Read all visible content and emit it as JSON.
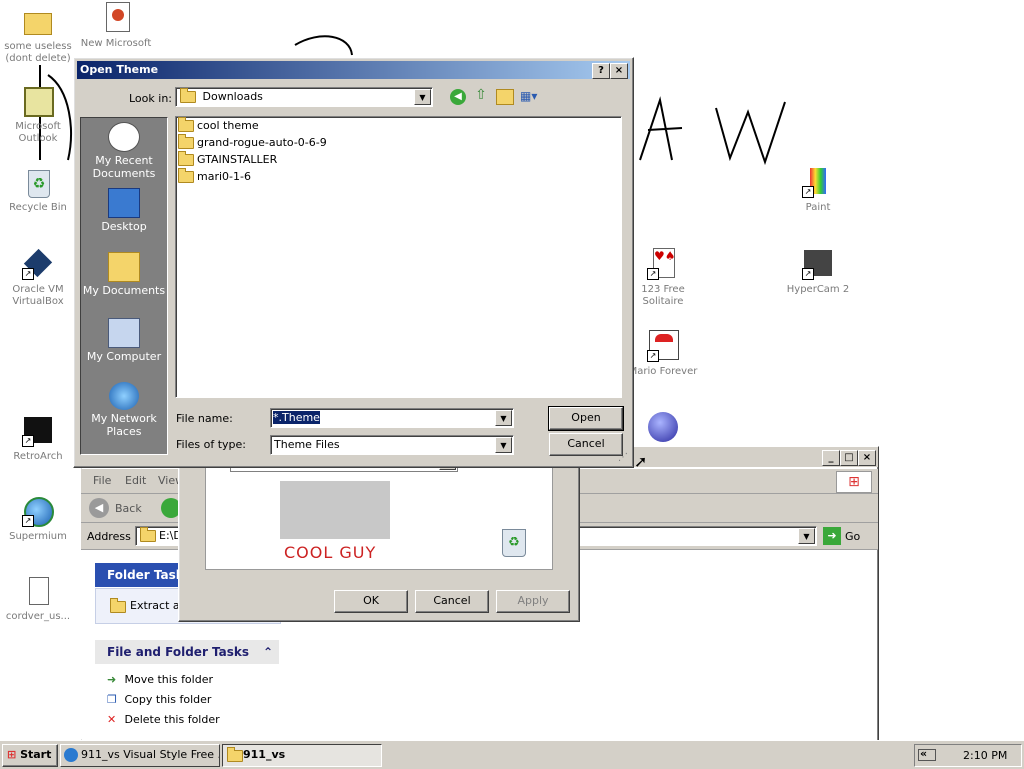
{
  "desktop": {
    "icons": [
      {
        "label": "some useless (dont delete)",
        "icon": "folder-icon"
      },
      {
        "label": "New Microsoft",
        "icon": "powerpoint-icon"
      },
      {
        "label": "Microsoft Outlook",
        "icon": "outlook-icon"
      },
      {
        "label": "Recycle Bin",
        "icon": "recycle-bin-icon"
      },
      {
        "label": "Oracle VM VirtualBox",
        "icon": "virtualbox-icon"
      },
      {
        "label": "RetroArch",
        "icon": "retroarch-icon"
      },
      {
        "label": "Supermium",
        "icon": "browser-icon"
      },
      {
        "label": "cordver_us...",
        "icon": "document-icon"
      },
      {
        "label": "Paint",
        "icon": "paint-icon"
      },
      {
        "label": "HyperCam 2",
        "icon": "camera-icon"
      },
      {
        "label": "123 Free Solitaire",
        "icon": "cards-icon"
      },
      {
        "label": "Mario Forever",
        "icon": "mario-icon"
      }
    ],
    "scribble": "A W"
  },
  "background_window": {
    "menu": [
      "File",
      "Edit",
      "View"
    ],
    "back_label": "Back",
    "address_label": "Address",
    "address_value": "E:\\D",
    "go_label": "Go",
    "folder_tasks_title": "Folder Tasks",
    "extract_label": "Extract al",
    "file_folder_tasks_title": "File and Folder Tasks",
    "tasks": [
      "Move this folder",
      "Copy this folder",
      "Delete this folder"
    ]
  },
  "display_props": {
    "preview_text": "COOL GUY",
    "ok_label": "OK",
    "cancel_label": "Cancel",
    "apply_label": "Apply"
  },
  "dialog": {
    "title": "Open Theme",
    "help_btn": "?",
    "close_btn": "×",
    "look_in_label": "Look in:",
    "look_in_value": "Downloads",
    "places": [
      "My Recent Documents",
      "Desktop",
      "My Documents",
      "My Computer",
      "My Network Places"
    ],
    "files": [
      "cool theme",
      "grand-rogue-auto-0-6-9",
      "GTAINSTALLER",
      "mari0-1-6"
    ],
    "file_name_label": "File name:",
    "file_name_value": "*.Theme",
    "file_type_label": "Files of type:",
    "file_type_value": "Theme Files",
    "open_label": "Open",
    "cancel_label": "Cancel"
  },
  "taskbar": {
    "start_label": "Start",
    "tasks": [
      "911_vs Visual Style Free ...",
      "911_vs"
    ],
    "clock": "2:10 PM",
    "tray_arrow": "«"
  },
  "colors": {
    "title_active": "#0a246a",
    "dialog_face": "#d4d0c8",
    "places_bar": "#808080",
    "preview_red": "#cc2222"
  }
}
